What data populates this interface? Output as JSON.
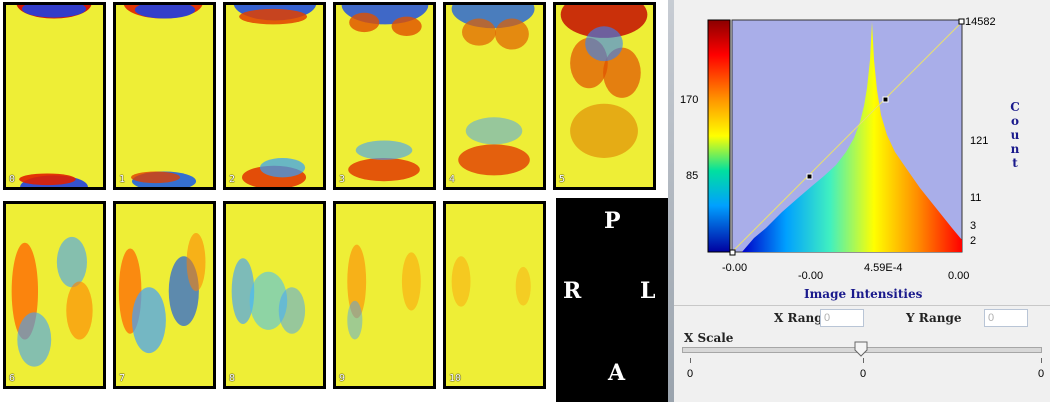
{
  "slices": [
    {
      "label": "0"
    },
    {
      "label": "1"
    },
    {
      "label": "2"
    },
    {
      "label": "3"
    },
    {
      "label": "4"
    },
    {
      "label": "5"
    },
    {
      "label": "6"
    },
    {
      "label": "7"
    },
    {
      "label": "8"
    },
    {
      "label": "9"
    },
    {
      "label": "10"
    }
  ],
  "orientation": {
    "top": "P",
    "left": "R",
    "right": "L",
    "bottom": "A"
  },
  "histogram": {
    "left_ticks": [
      "170",
      "85"
    ],
    "right_ticks": [
      "14582",
      "121",
      "11",
      "3",
      "2"
    ],
    "x_ticks": [
      "-0.00",
      "-0.00",
      "4.59E-4",
      "0.00"
    ],
    "xlabel": "Image Intensities",
    "ylabel": "Count",
    "bg_color": "#a9aee9",
    "line_color": "#e8e070"
  },
  "controls": {
    "x_range_label": "X Range",
    "x_range_value": "0",
    "y_range_label": "Y Range",
    "y_range_value": "0",
    "x_scale_label": "X Scale",
    "slider_ticks": [
      "0",
      "0",
      "0"
    ],
    "slider_position": 0.5
  }
}
